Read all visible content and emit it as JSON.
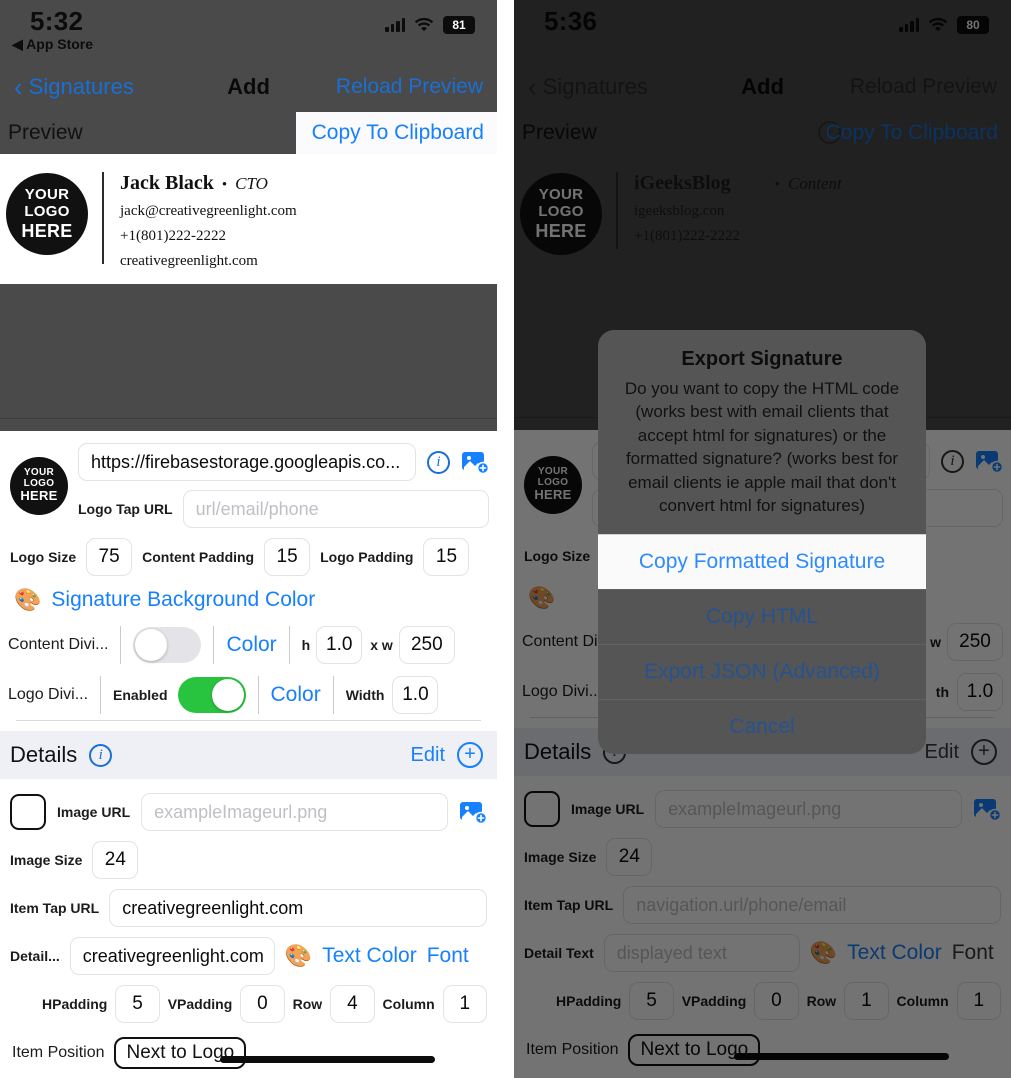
{
  "left_phone": {
    "status": {
      "time": "5:32",
      "back_app": "App Store",
      "battery": "81"
    },
    "nav": {
      "back_label": "Signatures",
      "title": "Add",
      "right_action": "Reload Preview"
    },
    "preview_bar": {
      "label": "Preview",
      "info_icon": "info-circle-icon",
      "copy_button": "Copy To Clipboard"
    },
    "signature": {
      "logo_lines": [
        "YOUR",
        "LOGO",
        "HERE"
      ],
      "name": "Jack Black",
      "separator": "•",
      "job_title": "CTO",
      "email": "jack@creativegreenlight.com",
      "phone": "+1(801)222-2222",
      "website": "creativegreenlight.com"
    },
    "logo_section": {
      "image_url_value": "https://firebasestorage.googleapis.co...",
      "info_icon": "info-circle-icon",
      "image_picker_icon": "add-image-icon",
      "logo_tap_url_label": "Logo Tap URL",
      "logo_tap_url_placeholder": "url/email/phone",
      "logo_size_label": "Logo Size",
      "logo_size_value": "75",
      "content_padding_label": "Content Padding",
      "content_padding_value": "15",
      "logo_padding_label": "Logo Padding",
      "logo_padding_value": "15"
    },
    "background_color": {
      "icon": "palette-icon",
      "label": "Signature Background Color"
    },
    "content_divider": {
      "label": "Content Divi...",
      "toggle_on": false,
      "color_label": "Color",
      "h_label": "h",
      "h_value": "1.0",
      "x_label": "x w",
      "w_value": "250"
    },
    "logo_divider": {
      "label": "Logo Divi...",
      "enabled_label": "Enabled",
      "toggle_on": true,
      "color_label": "Color",
      "width_label": "Width",
      "width_value": "1.0"
    },
    "details_header": {
      "title": "Details",
      "info_icon": "info-circle-icon",
      "edit_label": "Edit",
      "add_icon": "plus-circle-icon"
    },
    "detail_item": {
      "swatch": "color-swatch",
      "image_url_label": "Image URL",
      "image_url_placeholder": "exampleImageurl.png",
      "image_picker_icon": "add-image-icon",
      "image_size_label": "Image Size",
      "image_size_value": "24",
      "item_tap_url_label": "Item Tap URL",
      "item_tap_url_value": "creativegreenlight.com",
      "detail_text_label": "Detail...",
      "detail_text_value": "creativegreenlight.com",
      "text_color_icon": "palette-icon",
      "text_color_label": "Text Color",
      "font_label": "Font",
      "hpadding_label": "HPadding",
      "hpadding_value": "5",
      "vpadding_label": "VPadding",
      "vpadding_value": "0",
      "row_label": "Row",
      "row_value": "4",
      "column_label": "Column",
      "column_value": "1",
      "item_position_label": "Item Position",
      "item_position_value": "Next to Logo"
    }
  },
  "right_phone": {
    "status": {
      "time": "5:36",
      "battery": "80"
    },
    "nav": {
      "back_label": "Signatures",
      "title": "Add",
      "right_action": "Reload Preview"
    },
    "preview_bar": {
      "label": "Preview",
      "info_icon": "info-circle-icon",
      "copy_button": "Copy To Clipboard"
    },
    "signature": {
      "logo_lines": [
        "YOUR",
        "LOGO",
        "HERE"
      ],
      "name": "iGeeksBlog",
      "separator": "•",
      "job_title": "Content",
      "email": "igeeksblog.con",
      "phone": "+1(801)222-2222"
    },
    "logo_section": {
      "info_icon": "info-circle-icon",
      "image_picker_icon": "add-image-icon",
      "logo_size_label": "Logo Size"
    },
    "content_divider": {
      "label": "Content Di",
      "w_label": "w",
      "w_value": "250"
    },
    "logo_divider": {
      "label": "Logo Divi..",
      "width_label": "th",
      "width_value": "1.0"
    },
    "details_header": {
      "title": "Details",
      "info_icon": "info-circle-icon",
      "edit_label": "Edit",
      "add_icon": "plus-circle-icon"
    },
    "detail_item": {
      "swatch": "color-swatch",
      "image_url_label": "Image URL",
      "image_url_placeholder": "exampleImageurl.png",
      "image_picker_icon": "add-image-icon",
      "image_size_label": "Image Size",
      "image_size_value": "24",
      "item_tap_url_label": "Item Tap URL",
      "item_tap_url_placeholder": "navigation.url/phone/email",
      "detail_text_label": "Detail Text",
      "detail_text_placeholder": "displayed text",
      "text_color_icon": "palette-icon",
      "text_color_label": "Text Color",
      "font_label": "Font",
      "hpadding_label": "HPadding",
      "hpadding_value": "5",
      "vpadding_label": "VPadding",
      "vpadding_value": "0",
      "row_label": "Row",
      "row_value": "1",
      "column_label": "Column",
      "column_value": "1",
      "item_position_label": "Item Position",
      "item_position_value": "Next to Logo"
    },
    "alert": {
      "title": "Export Signature",
      "message": "Do you want to copy the HTML code (works best with email clients that accept html for signatures) or the formatted signature? (works best for email clients ie apple mail that don't convert html for signatures)",
      "buttons": [
        {
          "label": "Copy Formatted Signature",
          "highlighted": true
        },
        {
          "label": "Copy HTML",
          "highlighted": false
        },
        {
          "label": "Export JSON (Advanced)",
          "highlighted": false
        },
        {
          "label": "Cancel",
          "highlighted": false
        }
      ]
    }
  },
  "colors": {
    "accent_blue": "#1780ff",
    "nav_blue": "#1a6fd4",
    "toggle_green": "#28c43f",
    "chrome_gray": "#4a4a4a",
    "section_header": "#eef0f5"
  }
}
